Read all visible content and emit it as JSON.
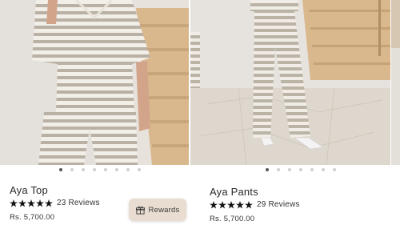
{
  "products": [
    {
      "name": "Aya Top",
      "rating": 5,
      "reviews": "23 Reviews",
      "price": "Rs. 5,700.00",
      "image_dots": 8,
      "active_dot": 0
    },
    {
      "name": "Aya Pants",
      "rating": 5,
      "reviews": "29 Reviews",
      "price": "Rs. 5,700.00",
      "image_dots": 7,
      "active_dot": 0
    }
  ],
  "rewards": {
    "label": "Rewards",
    "icon": "gift-icon"
  },
  "colors": {
    "stripe_light": "#f2eee8",
    "stripe_dark": "#b9b1a4",
    "wall": "#e4e1dc",
    "stairs": "#d5b58d",
    "floor": "#ded8cf"
  }
}
